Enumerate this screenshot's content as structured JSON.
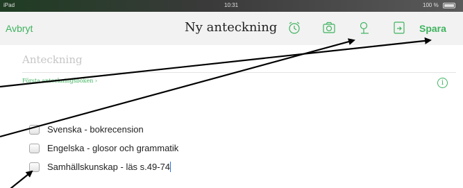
{
  "status_bar": {
    "device": "iPad",
    "time": "10:31",
    "battery": "100 %"
  },
  "nav": {
    "cancel_label": "Avbryt",
    "title": "Ny anteckning",
    "save_label": "Spara",
    "icons": [
      "alarm-clock-icon",
      "camera-icon",
      "map-pin-icon",
      "share-icon"
    ]
  },
  "note": {
    "title_placeholder": "Anteckning",
    "notebook_label": "Första anteckningsboken ›",
    "checklist": [
      {
        "label": "Svenska - bokrecension",
        "checked": false
      },
      {
        "label": "Engelska - glosor och grammatik",
        "checked": false
      },
      {
        "label": "Samhällskunskap - läs s.49-74",
        "checked": false
      }
    ]
  },
  "colors": {
    "accent": "#3eb35e",
    "arrow": "#000000"
  }
}
